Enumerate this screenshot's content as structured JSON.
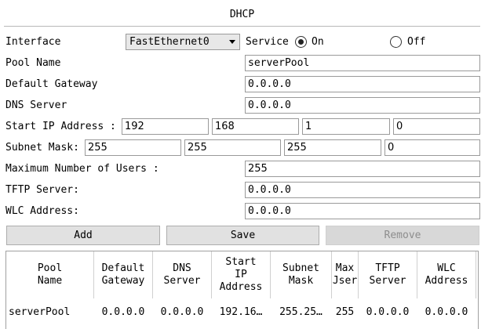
{
  "window": {
    "title": "DHCP"
  },
  "form": {
    "interface_label": "Interface",
    "interface_value": "FastEthernet0",
    "service_label": "Service",
    "service_on_label": "On",
    "service_off_label": "Off",
    "service_state": "On",
    "pool_name_label": "Pool Name",
    "pool_name_value": "serverPool",
    "default_gateway_label": "Default Gateway",
    "default_gateway_value": "0.0.0.0",
    "dns_server_label": "DNS Server",
    "dns_server_value": "0.0.0.0",
    "start_ip_label": "Start IP Address :",
    "start_ip": [
      "192",
      "168",
      "1",
      "0"
    ],
    "subnet_mask_label": "Subnet Mask:",
    "subnet_mask": [
      "255",
      "255",
      "255",
      "0"
    ],
    "max_users_label": "Maximum Number of Users :",
    "max_users_value": "255",
    "tftp_label": "TFTP Server:",
    "tftp_value": "0.0.0.0",
    "wlc_label": "WLC Address:",
    "wlc_value": "0.0.0.0"
  },
  "buttons": {
    "add": "Add",
    "save": "Save",
    "remove": "Remove"
  },
  "table": {
    "headers": [
      "Pool\nName",
      "Default\nGateway",
      "DNS\nServer",
      "Start\nIP\nAddress",
      "Subnet\nMask",
      "Max\nJser",
      "TFTP\nServer",
      "WLC\nAddress"
    ],
    "rows": [
      [
        "serverPool",
        "0.0.0.0",
        "0.0.0.0",
        "192.16…",
        "255.25…",
        "255",
        "0.0.0.0",
        "0.0.0.0"
      ]
    ]
  }
}
